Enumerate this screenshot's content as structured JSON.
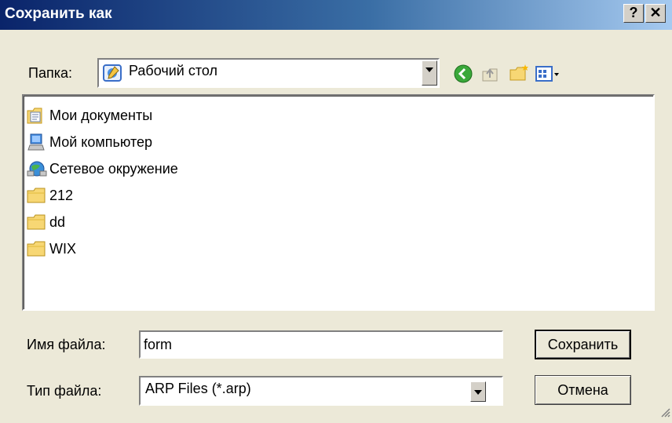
{
  "window": {
    "title": "Сохранить как",
    "help_label": "?",
    "close_label": "✕"
  },
  "location": {
    "label": "Папка:",
    "value": "Рабочий стол",
    "icon": "desktop-icon"
  },
  "toolbar": {
    "back_icon": "back-arrow-icon",
    "up_icon": "up-folder-icon",
    "new_folder_icon": "new-folder-icon",
    "views_icon": "views-menu-icon"
  },
  "files": [
    {
      "name": "Мои документы",
      "icon": "my-documents-icon"
    },
    {
      "name": "Мой компьютер",
      "icon": "my-computer-icon"
    },
    {
      "name": "Сетевое окружение",
      "icon": "network-places-icon"
    },
    {
      "name": "212",
      "icon": "folder-icon"
    },
    {
      "name": "dd",
      "icon": "folder-icon"
    },
    {
      "name": "WIX",
      "icon": "folder-icon"
    }
  ],
  "filename": {
    "label": "Имя файла:",
    "value": "form"
  },
  "filetype": {
    "label": "Тип файла:",
    "value": "ARP Files (*.arp)"
  },
  "buttons": {
    "save": "Сохранить",
    "cancel": "Отмена"
  }
}
